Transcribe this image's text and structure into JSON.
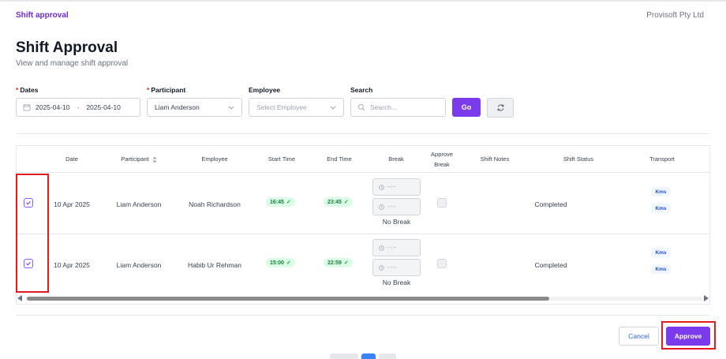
{
  "header": {
    "breadcrumb": "Shift approval",
    "company": "Provisoft Pty Ltd"
  },
  "page": {
    "title": "Shift Approval",
    "subtitle": "View and manage shift approval"
  },
  "filters": {
    "dates_label": "Dates",
    "date_from": "2025-04-10",
    "date_separator": "-",
    "date_to": "2025-04-10",
    "participant_label": "Participant",
    "participant_value": "Liam Anderson",
    "employee_label": "Employee",
    "employee_placeholder": "Select Employee",
    "search_label": "Search",
    "search_placeholder": "Search...",
    "go_label": "Go",
    "required_marker": "*"
  },
  "table": {
    "columns": {
      "date": "Date",
      "participant": "Participant",
      "employee": "Employee",
      "start_time": "Start Time",
      "end_time": "End Time",
      "break": "Break",
      "approve_break_1": "Approve",
      "approve_break_2": "Break",
      "shift_notes": "Shift Notes",
      "shift_status": "Shift Status",
      "transport": "Transport"
    },
    "rows": [
      {
        "checked": true,
        "date": "10 Apr 2025",
        "participant": "Liam Anderson",
        "employee": "Noah Richardson",
        "start_time": "16:45",
        "end_time": "23:45",
        "break_start": "--:--",
        "break_end": "--:--",
        "break_text": "No Break",
        "shift_status": "Completed",
        "transport_1": "Kms",
        "transport_2": "Kms"
      },
      {
        "checked": true,
        "date": "10 Apr 2025",
        "participant": "Liam Anderson",
        "employee": "Habib Ur Rehman",
        "start_time": "15:00",
        "end_time": "22:59",
        "break_start": "--:--",
        "break_end": "--:--",
        "break_text": "No Break",
        "shift_status": "Completed",
        "transport_1": "Kms",
        "transport_2": "Kms"
      }
    ]
  },
  "actions": {
    "cancel": "Cancel",
    "approve": "Approve"
  },
  "pagination": {
    "current_page": 1
  },
  "colors": {
    "brand": "#7c3aed",
    "highlight": "#e11d1d",
    "status_green": "#16a34a",
    "link_blue": "#2563eb"
  },
  "icons": {
    "calendar": "calendar-icon",
    "search": "search-icon",
    "refresh": "refresh-icon",
    "clock": "clock-icon",
    "sort": "sort-icon",
    "chevron": "chevron-down-icon",
    "check": "check-icon"
  }
}
